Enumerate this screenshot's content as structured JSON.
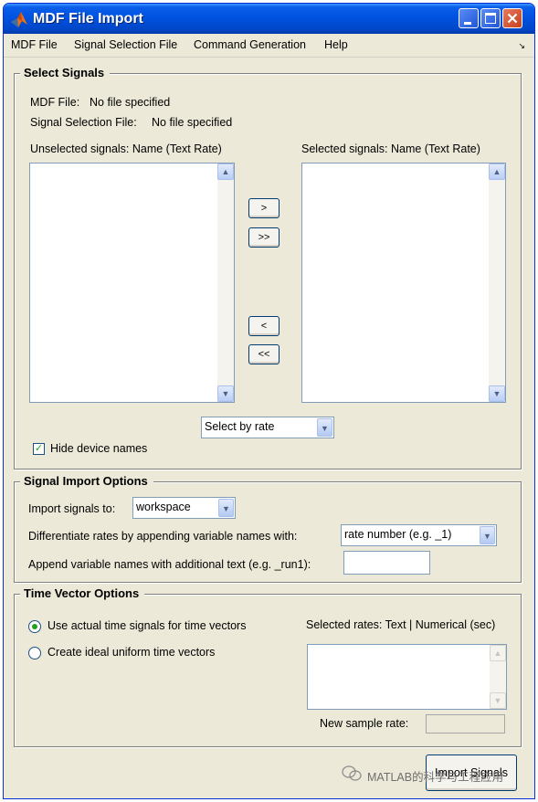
{
  "window": {
    "title": "MDF File Import",
    "menu": [
      "MDF File",
      "Signal Selection File",
      "Command Generation",
      "Help"
    ],
    "menu_overflow": "↘"
  },
  "select_signals": {
    "legend": "Select Signals",
    "mdf_file_label": "MDF File:",
    "mdf_file_value": "No file specified",
    "selection_file_label": "Signal Selection File:",
    "selection_file_value": "No file specified",
    "unselected_header": "Unselected signals: Name (Text Rate)",
    "selected_header": "Selected signals: Name (Text Rate)",
    "add_one": ">",
    "add_all": ">>",
    "remove_one": "<",
    "remove_all": "<<",
    "select_by": "Select by rate",
    "hide_device_names_label": "Hide device names",
    "hide_device_names_checked": true
  },
  "signal_import_options": {
    "legend": "Signal Import Options",
    "import_to_label": "Import signals to:",
    "import_to_value": "workspace",
    "differentiate_label": "Differentiate rates by appending variable names with:",
    "differentiate_value": "rate number (e.g. _1)",
    "append_label": "Append variable names with additional text (e.g. _run1):",
    "append_value": ""
  },
  "time_vector_options": {
    "legend": "Time Vector Options",
    "option_actual": "Use actual time signals for time vectors",
    "option_ideal": "Create ideal uniform time vectors",
    "selected_option": "actual",
    "selected_rates_label": "Selected rates: Text | Numerical (sec)",
    "new_sample_rate_label": "New sample rate:",
    "new_sample_rate_value": ""
  },
  "footer": {
    "import_button_label": "Import Signals",
    "watermark_text": "MATLAB的科学与工程应用"
  },
  "icons": {
    "app": "matlab-logo-icon",
    "scroll_up": "▲",
    "scroll_down": "▼",
    "dropdown": "▼",
    "check": "✓"
  },
  "colors": {
    "titlebar": "#0054e3",
    "window_face": "#ece9d8",
    "close_button": "#c3401e",
    "check_green": "#21a121"
  }
}
